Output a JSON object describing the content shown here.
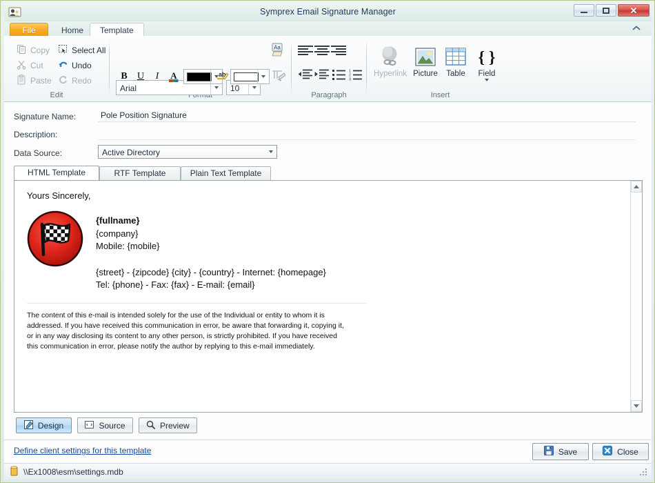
{
  "window": {
    "title": "Symprex Email Signature Manager",
    "icon": "user-card-icon",
    "controls": {
      "minimize": "minimize-icon",
      "maximize": "maximize-icon",
      "close": "close-icon"
    }
  },
  "ribbon": {
    "tabs": [
      {
        "label": "File",
        "active": false,
        "id": "file"
      },
      {
        "label": "Home",
        "active": false,
        "id": "home"
      },
      {
        "label": "Template",
        "active": true,
        "id": "template"
      }
    ],
    "collapse_icon": "chevron-up-icon",
    "groups": [
      {
        "id": "edit",
        "label": "Edit",
        "items": [
          {
            "label": "Copy",
            "icon": "copy-icon",
            "enabled": false
          },
          {
            "label": "Cut",
            "icon": "scissors-icon",
            "enabled": false
          },
          {
            "label": "Paste",
            "icon": "clipboard-icon",
            "enabled": false
          },
          {
            "label": "Select All",
            "icon": "select-all-icon",
            "enabled": true
          },
          {
            "label": "Undo",
            "icon": "undo-arrow-icon",
            "enabled": true
          },
          {
            "label": "Redo",
            "icon": "redo-arrow-icon",
            "enabled": false
          }
        ]
      },
      {
        "id": "format",
        "label": "Format",
        "font_name": "Arial",
        "font_size": "10",
        "buttons": [
          {
            "label": "B",
            "name": "bold-button"
          },
          {
            "label": "U",
            "name": "underline-button"
          },
          {
            "label": "I",
            "name": "italic-button"
          },
          {
            "label": "A",
            "name": "font-color-a-icon"
          }
        ],
        "font_color": "#000000",
        "highlight_color": "#ffffff",
        "change_case_icon": "change-case-icon",
        "clear_format_icon": "clear-formatting-icon",
        "spelling_icon": "spelling-ab-icon"
      },
      {
        "id": "paragraph",
        "label": "Paragraph",
        "items": [
          {
            "name": "align-left-icon"
          },
          {
            "name": "align-center-icon"
          },
          {
            "name": "align-right-icon"
          },
          {
            "name": "decrease-indent-icon"
          },
          {
            "name": "increase-indent-icon"
          },
          {
            "name": "bullet-list-icon"
          },
          {
            "name": "numbered-list-icon"
          }
        ]
      },
      {
        "id": "insert",
        "label": "Insert",
        "items": [
          {
            "label": "Hyperlink",
            "icon": "hyperlink-icon",
            "enabled": false
          },
          {
            "label": "Picture",
            "icon": "picture-icon",
            "enabled": true
          },
          {
            "label": "Table",
            "icon": "table-icon",
            "enabled": true
          },
          {
            "label": "Field",
            "icon": "field-braces-icon",
            "enabled": true,
            "has_dropdown": true
          }
        ]
      }
    ]
  },
  "form": {
    "signature_name_label": "Signature Name:",
    "signature_name_value": "Pole Position Signature",
    "description_label": "Description:",
    "description_value": "",
    "description_placeholder": "",
    "data_source_label": "Data Source:",
    "data_source_value": "Active Directory"
  },
  "template_tabs": [
    {
      "label": "HTML Template",
      "active": true
    },
    {
      "label": "RTF Template",
      "active": false
    },
    {
      "label": "Plain Text Template",
      "active": false
    }
  ],
  "signature": {
    "salutation": "Yours Sincerely,",
    "logo_alt": "racing-flag-logo",
    "fullname": "{fullname}",
    "company": "{company}",
    "mobile": "Mobile: {mobile}",
    "address_line": "{street} - {zipcode} {city} - {country} - Internet: {homepage}",
    "contact_line": "Tel: {phone} - Fax: {fax} - E-mail: {email}",
    "disclaimer": "The content of this e-mail is intended solely for the use of the Individual or entity to whom it is addressed. If you have received this communication in error, be aware that forwarding it, copying it, or in any way disclosing its content to any other person, is strictly prohibited. If you have received this communication in error, please notify the author by replying to this e-mail immediately."
  },
  "view_buttons": [
    {
      "label": "Design",
      "icon": "design-view-icon",
      "active": true
    },
    {
      "label": "Source",
      "icon": "source-view-icon",
      "active": false
    },
    {
      "label": "Preview",
      "icon": "magnifier-icon",
      "active": false
    }
  ],
  "footer": {
    "link": "Define client settings for this template",
    "save": "Save",
    "save_icon": "floppy-disk-icon",
    "close": "Close",
    "close_icon": "close-x-icon"
  },
  "statusbar": {
    "icon": "database-icon",
    "path": "\\\\Ex1008\\esm\\settings.mdb"
  },
  "colors": {
    "window_border": "#b7c48a",
    "file_tab": "#f7ad23",
    "link": "#16499b",
    "logo_red": "#e1251b",
    "active_button": "#a9d4f2"
  }
}
